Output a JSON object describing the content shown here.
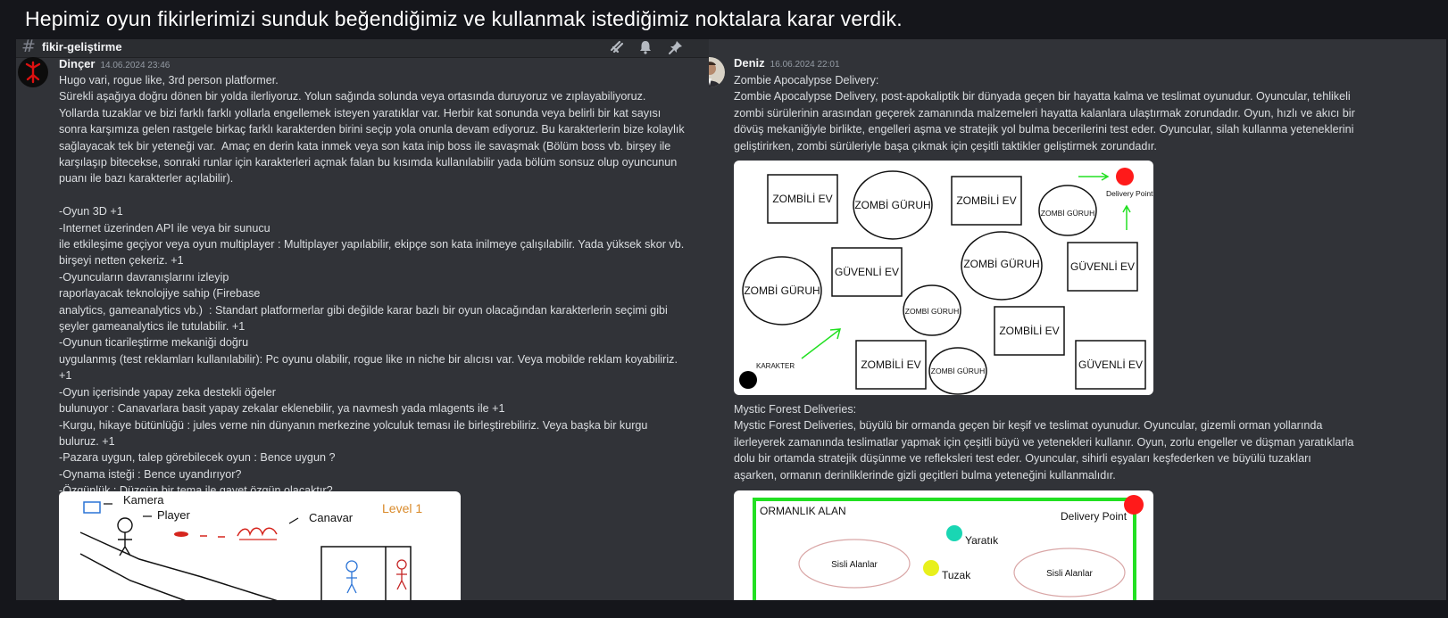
{
  "slide": {
    "title": "Hepimiz oyun fikirlerimizi sunduk beğendiğimiz ve kullanmak istediğimiz noktalara karar verdik."
  },
  "channel": {
    "name": "fikir-geliştirme",
    "hash": "#"
  },
  "left_message": {
    "author": "Dinçer",
    "timestamp": "14.06.2024 23:46",
    "lines": [
      "Hugo vari, rogue like, 3rd person platformer.",
      "Sürekli aşağıya doğru dönen bir yolda ilerliyoruz. Yolun sağında solunda veya ortasında duruyoruz ve zıplayabiliyoruz.",
      "Yollarda tuzaklar ve bizi farklı farklı yollarla engellemek isteyen yaratıklar var. Herbir kat sonunda veya belirli bir kat sayısı",
      "sonra karşımıza gelen rastgele birkaç farklı karakterden birini seçip yola onunla devam ediyoruz. Bu karakterlerin bize kolaylık",
      "sağlayacak tek bir yeteneği var.  Amaç en derin kata inmek veya son kata inip boss ile savaşmak (Bölüm boss vb. birşey ile",
      "karşılaşıp bitecekse, sonraki runlar için karakterleri açmak falan bu kısımda kullanılabilir yada bölüm sonsuz olup oyuncunun",
      "puanı ile bazı karakterler açılabilir).",
      "",
      "-Oyun 3D +1",
      "-Internet üzerinden API ile veya bir sunucu",
      "ile etkileşime geçiyor veya oyun multiplayer : Multiplayer yapılabilir, ekipçe son kata inilmeye çalışılabilir. Yada yüksek skor vb.",
      "birşeyi netten çekeriz. +1",
      "-Oyuncuların davranışlarını izleyip",
      "raporlayacak teknolojiye sahip (Firebase",
      "analytics, gameanalytics vb.)  : Standart platformerlar gibi değilde karar bazlı bir oyun olacağından karakterlerin seçimi gibi",
      "şeyler gameanalytics ile tutulabilir. +1",
      "-Oyunun ticarileştirme mekaniği doğru",
      "uygulanmış (test reklamları kullanılabilir): Pc oyunu olabilir, rogue like ın niche bir alıcısı var. Veya mobilde reklam koyabiliriz.",
      "+1",
      "-Oyun içerisinde yapay zeka destekli öğeler",
      "bulunuyor : Canavarlara basit yapay zekalar eklenebilir, ya navmesh yada mlagents ile +1",
      "-Kurgu, hikaye bütünlüğü : jules verne nin dünyanın merkezine yolculuk teması ile birleştirebiliriz. Veya başka bir kurgu",
      "buluruz. +1",
      "-Pazara uygun, talep görebilecek oyun : Bence uygun ?",
      "-Oynama isteği : Bence uyandırıyor?",
      "-Özgünlük : Düzgün bir tema ile gayet özgün olacaktır?"
    ],
    "sketch": {
      "camera": "Kamera",
      "player": "Player",
      "monster": "Canavar",
      "level": "Level 1"
    }
  },
  "right_message": {
    "author": "Deniz",
    "timestamp": "16.06.2024 22:01",
    "block1": [
      "Zombie Apocalypse Delivery:",
      "Zombie Apocalypse Delivery, post-apokaliptik bir dünyada geçen bir hayatta kalma ve teslimat oyunudur. Oyuncular, tehlikeli",
      "zombi sürülerinin arasından geçerek zamanında malzemeleri hayatta kalanlara ulaştırmak zorundadır. Oyun, hızlı ve akıcı bir",
      "dövüş mekaniğiyle birlikte, engelleri aşma ve stratejik yol bulma becerilerini test eder. Oyuncular, silah kullanma yeteneklerini",
      "geliştirirken, zombi sürüleriyle başa çıkmak için çeşitli taktikler geliştirmek zorundadır."
    ],
    "map1": {
      "zombili_ev": "ZOMBİLİ EV",
      "zombi_guruh": "ZOMBİ GÜRUH",
      "guvenli_ev": "GÜVENLİ EV",
      "delivery_point": "Delivery Point",
      "karakter": "KARAKTER"
    },
    "block2": [
      "Mystic Forest Deliveries:",
      "Mystic Forest Deliveries, büyülü bir ormanda geçen bir keşif ve teslimat oyunudur. Oyuncular, gizemli orman yollarında",
      "ilerleyerek zamanında teslimatlar yapmak için çeşitli büyü ve yetenekleri kullanır. Oyun, zorlu engeller ve düşman yaratıklarla",
      "dolu bir ortamda stratejik düşünme ve refleksleri test eder. Oyuncular, sihirli eşyaları keşfederken ve büyülü tuzakları",
      "aşarken, ormanın derinliklerinde gizli geçitleri bulma yeteneğini kullanmalıdır."
    ],
    "map2": {
      "area": "ORMANLIK ALAN",
      "delivery_point": "Delivery Point",
      "creature": "Yaratık",
      "trap": "Tuzak",
      "misty_left": "Sisli Alanlar",
      "misty_right": "Sisli Alanlar"
    }
  },
  "colors": {
    "accent_red": "#ff1a1a",
    "green": "#22e022",
    "teal": "#19d6b3",
    "yellow": "#e8f01c"
  }
}
